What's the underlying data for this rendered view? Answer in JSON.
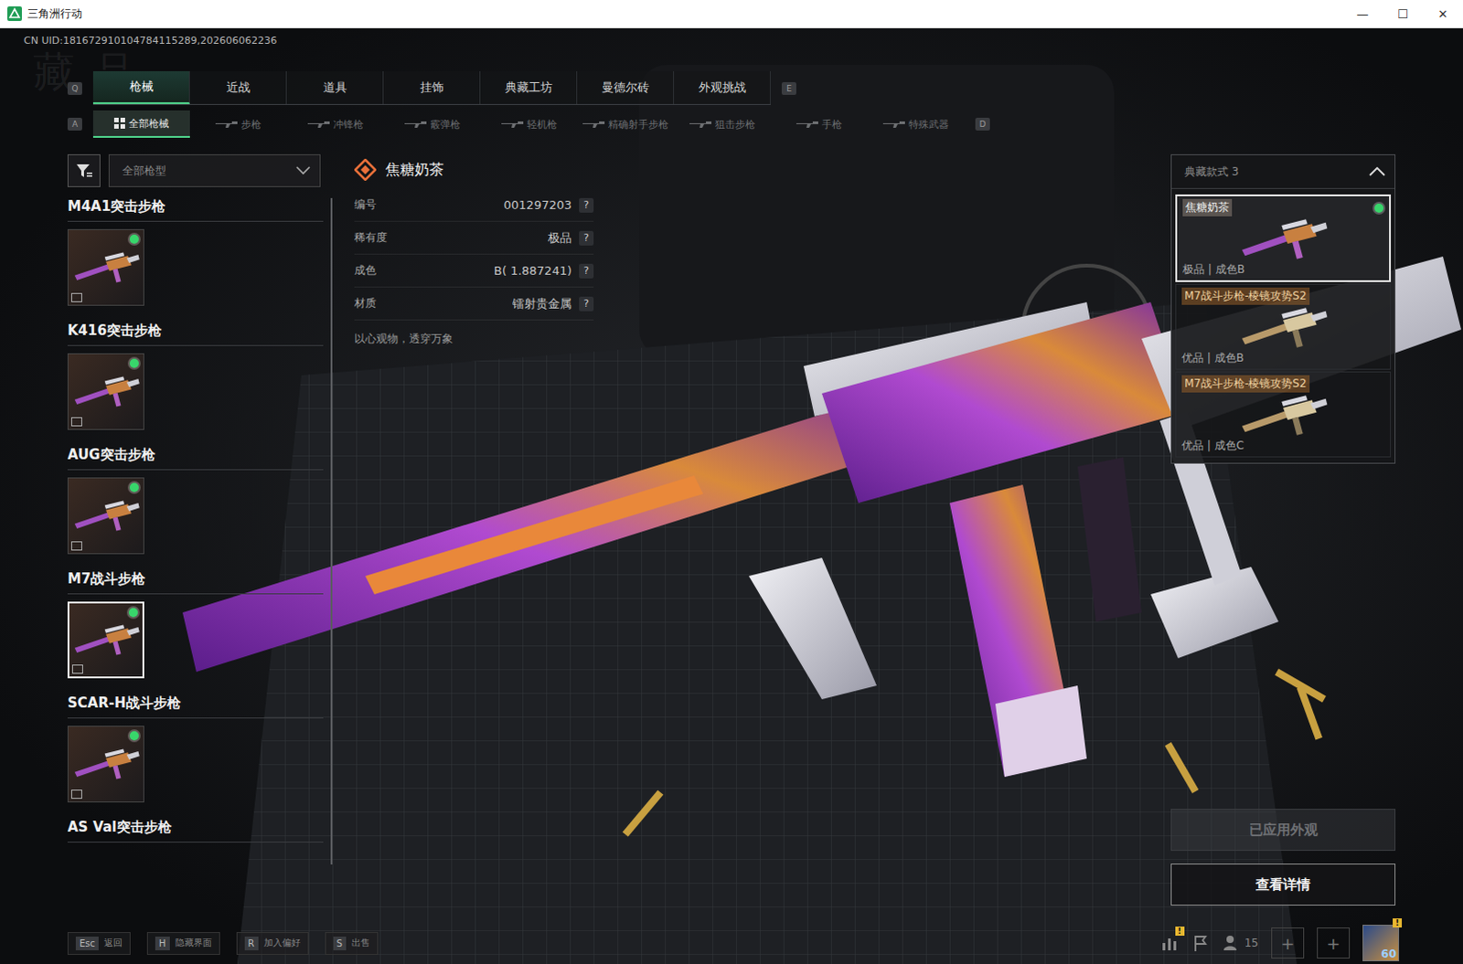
{
  "window": {
    "title": "三角洲行动",
    "controls": [
      "—",
      "☐",
      "✕"
    ]
  },
  "uid": "CN UID:181672910104784115289,202606062236",
  "watermark": "藏品",
  "tabs": {
    "prev_key": "Q",
    "next_key": "E",
    "items": [
      {
        "label": "枪械",
        "selected": true
      },
      {
        "label": "近战",
        "selected": false
      },
      {
        "label": "道具",
        "selected": false
      },
      {
        "label": "挂饰",
        "selected": false
      },
      {
        "label": "典藏工坊",
        "selected": false
      },
      {
        "label": "曼德尔砖",
        "selected": false
      },
      {
        "label": "外观挑战",
        "selected": false
      }
    ]
  },
  "subtabs": {
    "prev_key": "A",
    "next_key": "D",
    "items": [
      {
        "label": "全部枪械",
        "selected": true
      },
      {
        "label": "步枪",
        "selected": false
      },
      {
        "label": "冲锋枪",
        "selected": false
      },
      {
        "label": "霰弹枪",
        "selected": false
      },
      {
        "label": "轻机枪",
        "selected": false
      },
      {
        "label": "精确射手步枪",
        "selected": false
      },
      {
        "label": "狙击步枪",
        "selected": false
      },
      {
        "label": "手枪",
        "selected": false
      },
      {
        "label": "特殊武器",
        "selected": false
      }
    ]
  },
  "filter": {
    "dropdown": "全部枪型"
  },
  "weapons": [
    {
      "name": "M4A1突击步枪",
      "equipped": true,
      "selected": false
    },
    {
      "name": "K416突击步枪",
      "equipped": true,
      "selected": false
    },
    {
      "name": "AUG突击步枪",
      "equipped": true,
      "selected": false
    },
    {
      "name": "M7战斗步枪",
      "equipped": true,
      "selected": true
    },
    {
      "name": "SCAR-H战斗步枪",
      "equipped": true,
      "selected": false
    },
    {
      "name": "AS Val突击步枪",
      "equipped": true,
      "selected": false
    }
  ],
  "details": {
    "title": "焦糖奶茶",
    "help_glyph": "?",
    "rows": [
      {
        "label": "编号",
        "value": "001297203"
      },
      {
        "label": "稀有度",
        "value": "极品"
      },
      {
        "label": "成色",
        "value": "B( 1.887241)"
      },
      {
        "label": "材质",
        "value": "镭射贵金属"
      }
    ],
    "description": "以心观物，透穿万象"
  },
  "styles": {
    "dropdown": "典藏款式 3",
    "expanded": true,
    "items": [
      {
        "name": "焦糖奶茶",
        "meta": "极品 | 成色B",
        "selected": true,
        "equipped": true
      },
      {
        "name": "M7战斗步枪-棱镜攻势S2",
        "meta": "优品 | 成色B",
        "selected": false,
        "equipped": false
      },
      {
        "name": "M7战斗步枪-棱镜攻势S2",
        "meta": "优品 | 成色C",
        "selected": false,
        "equipped": false
      }
    ]
  },
  "buttons": [
    {
      "label": "已应用外观",
      "disabled": true
    },
    {
      "label": "查看详情",
      "disabled": false
    }
  ],
  "hotkeys": [
    {
      "key": "Esc",
      "label": "返回"
    },
    {
      "key": "H",
      "label": "隐藏界面"
    },
    {
      "key": "R",
      "label": "加入偏好"
    },
    {
      "key": "S",
      "label": "出售"
    }
  ],
  "tray": {
    "stats_badge": "!",
    "friends_count": "15",
    "add_slots": [
      "+",
      "+"
    ],
    "level": "60",
    "avatar_badge": "!"
  }
}
